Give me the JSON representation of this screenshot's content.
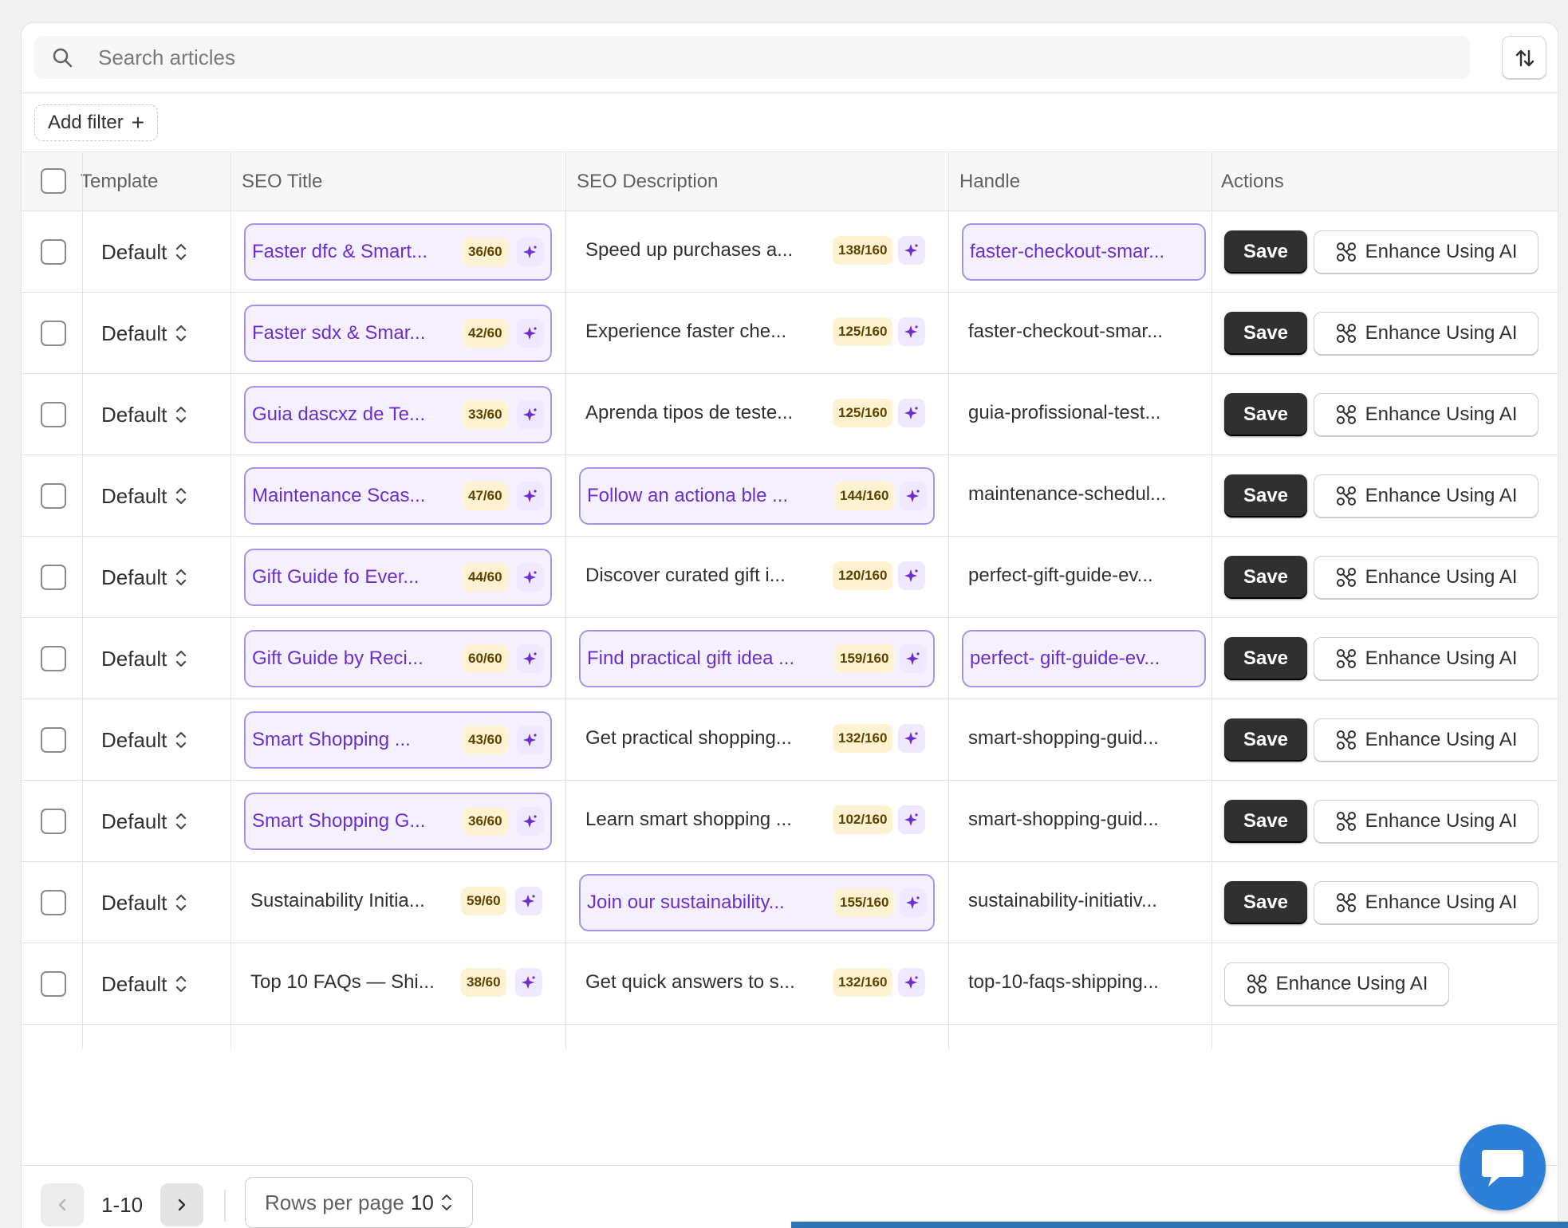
{
  "search": {
    "placeholder": "Search articles",
    "icon": "search-icon"
  },
  "sort_button": {
    "icon": "sort-arrows-icon"
  },
  "filter": {
    "add_label": "Add filter",
    "plus": "+"
  },
  "table": {
    "headers": {
      "template": "Template",
      "seo_title": "SEO Title",
      "seo_description": "SEO Description",
      "handle": "Handle",
      "actions": "Actions"
    },
    "rows": [
      {
        "template": "Default",
        "title": "Faster dfc & Smart...",
        "title_count": "36/60",
        "title_edited": true,
        "desc": "Speed up purchases a...",
        "desc_count": "138/160",
        "desc_edited": false,
        "handle": "faster-checkout-smar...",
        "handle_edited": true,
        "save_label": "Save",
        "ai_label": "Enhance Using AI"
      },
      {
        "template": "Default",
        "title": "Faster sdx & Smar...",
        "title_count": "42/60",
        "title_edited": true,
        "desc": "Experience faster che...",
        "desc_count": "125/160",
        "desc_edited": false,
        "handle": "faster-checkout-smar...",
        "handle_edited": false,
        "save_label": "Save",
        "ai_label": "Enhance Using AI"
      },
      {
        "template": "Default",
        "title": "Guia dascxz de Te...",
        "title_count": "33/60",
        "title_edited": true,
        "desc": "Aprenda tipos de teste...",
        "desc_count": "125/160",
        "desc_edited": false,
        "handle": "guia-profissional-test...",
        "handle_edited": false,
        "save_label": "Save",
        "ai_label": "Enhance Using AI"
      },
      {
        "template": "Default",
        "title": "Maintenance Scas...",
        "title_count": "47/60",
        "title_edited": true,
        "desc": "Follow an actiona ble ...",
        "desc_count": "144/160",
        "desc_edited": true,
        "handle": "maintenance-schedul...",
        "handle_edited": false,
        "save_label": "Save",
        "ai_label": "Enhance Using AI"
      },
      {
        "template": "Default",
        "title": "Gift Guide fo Ever...",
        "title_count": "44/60",
        "title_edited": true,
        "desc": "Discover curated gift i...",
        "desc_count": "120/160",
        "desc_edited": false,
        "handle": "perfect-gift-guide-ev...",
        "handle_edited": false,
        "save_label": "Save",
        "ai_label": "Enhance Using AI"
      },
      {
        "template": "Default",
        "title": "Gift Guide by  Reci...",
        "title_count": "60/60",
        "title_edited": true,
        "desc": "Find practical gift idea ...",
        "desc_count": "159/160",
        "desc_edited": true,
        "handle": "perfect- gift-guide-ev...",
        "handle_edited": true,
        "save_label": "Save",
        "ai_label": "Enhance Using AI"
      },
      {
        "template": "Default",
        "title": "Smart  Shopping ...",
        "title_count": "43/60",
        "title_edited": true,
        "desc": "Get practical shopping...",
        "desc_count": "132/160",
        "desc_edited": false,
        "handle": "smart-shopping-guid...",
        "handle_edited": false,
        "save_label": "Save",
        "ai_label": "Enhance Using AI"
      },
      {
        "template": "Default",
        "title": "Smart  Shopping G...",
        "title_count": "36/60",
        "title_edited": true,
        "desc": "Learn smart shopping ...",
        "desc_count": "102/160",
        "desc_edited": false,
        "handle": "smart-shopping-guid...",
        "handle_edited": false,
        "save_label": "Save",
        "ai_label": "Enhance Using AI"
      },
      {
        "template": "Default",
        "title": "Sustainability Initia...",
        "title_count": "59/60",
        "title_edited": false,
        "desc": "Join our  sustainability...",
        "desc_count": "155/160",
        "desc_edited": true,
        "handle": "sustainability-initiativ...",
        "handle_edited": false,
        "save_label": "Save",
        "ai_label": "Enhance Using AI"
      },
      {
        "template": "Default",
        "title": "Top 10 FAQs — Shi...",
        "title_count": "38/60",
        "title_edited": false,
        "desc": "Get quick answers to s...",
        "desc_count": "132/160",
        "desc_edited": false,
        "handle": "top-10-faqs-shipping...",
        "handle_edited": false,
        "save_label": null,
        "ai_label": "Enhance Using AI"
      }
    ]
  },
  "pagination": {
    "range": "1-10",
    "rows_per_page_label": "Rows per page",
    "rows_per_page_value": "10"
  },
  "colors": {
    "accent_purple": "#6b2fcf",
    "edited_bg": "#f4f0ff",
    "count_badge_bg": "#fff2d2",
    "primary_button": "#303030",
    "chat_button": "#2d7fd8"
  }
}
